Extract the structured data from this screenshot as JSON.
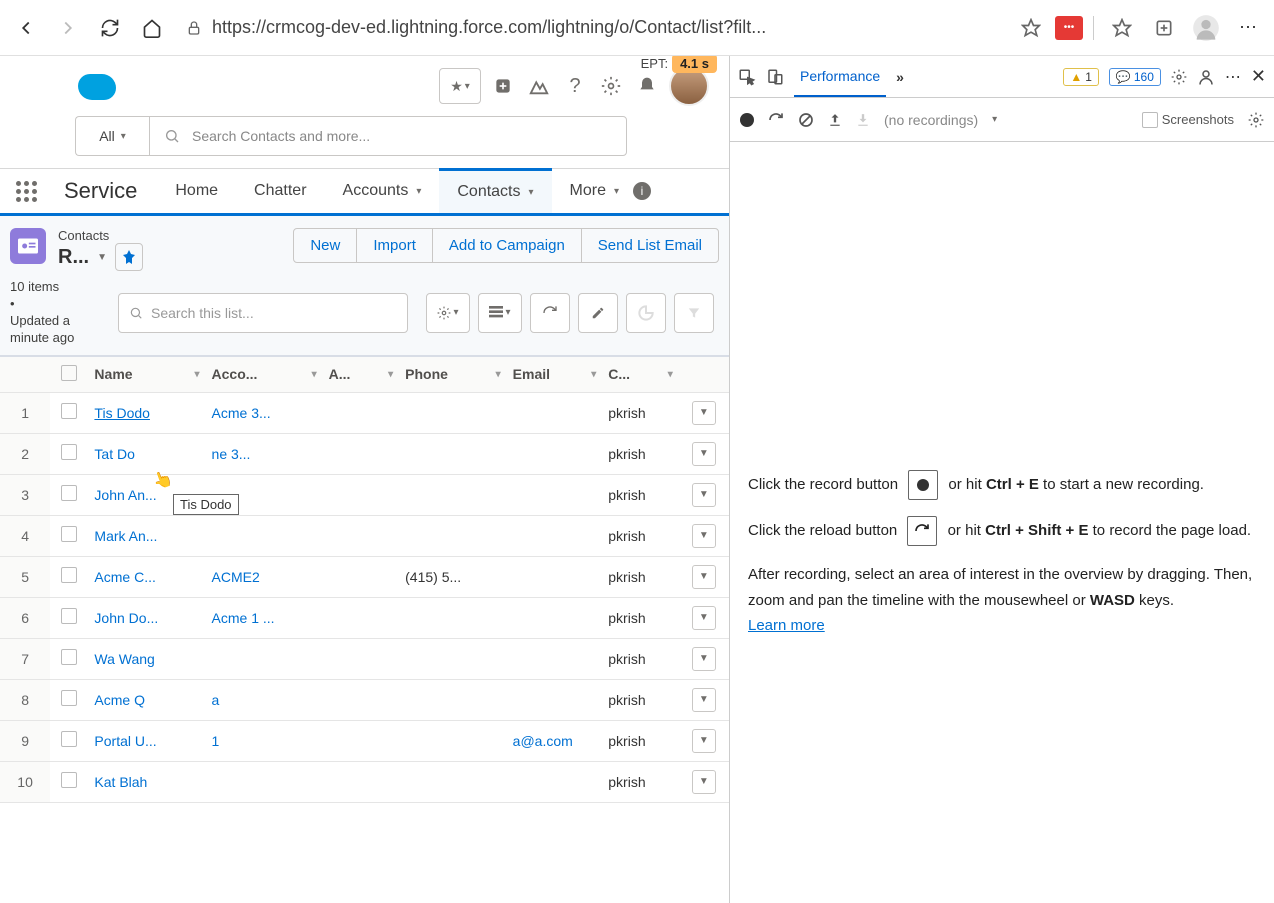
{
  "browser": {
    "url": "https://crmcog-dev-ed.lightning.force.com/lightning/o/Contact/list?filt..."
  },
  "sf": {
    "ept_label": "EPT:",
    "ept_value": "4.1 s",
    "search_scope": "All",
    "global_search_placeholder": "Search Contacts and more...",
    "app_name": "Service",
    "nav": {
      "home": "Home",
      "chatter": "Chatter",
      "accounts": "Accounts",
      "contacts": "Contacts",
      "more": "More"
    }
  },
  "list": {
    "object_label": "Contacts",
    "view_name": "R...",
    "actions": {
      "new": "New",
      "import": "Import",
      "campaign": "Add to Campaign",
      "send_email": "Send List Email"
    },
    "meta_items": "10 items",
    "meta_updated": "Updated a minute ago",
    "search_placeholder": "Search this list...",
    "tooltip": "Tis Dodo",
    "columns": {
      "name": "Name",
      "account": "Acco...",
      "a": "A...",
      "phone": "Phone",
      "email": "Email",
      "owner": "C..."
    },
    "rows": [
      {
        "num": "1",
        "name": "Tis Dodo",
        "account": "Acme 3...",
        "phone": "",
        "email": "",
        "owner": "pkrish"
      },
      {
        "num": "2",
        "name": "Tat Do",
        "account": "ne 3...",
        "phone": "",
        "email": "",
        "owner": "pkrish"
      },
      {
        "num": "3",
        "name": "John An...",
        "account": "",
        "phone": "",
        "email": "",
        "owner": "pkrish"
      },
      {
        "num": "4",
        "name": "Mark An...",
        "account": "",
        "phone": "",
        "email": "",
        "owner": "pkrish"
      },
      {
        "num": "5",
        "name": "Acme C...",
        "account": "ACME2",
        "phone": "(415) 5...",
        "email": "",
        "owner": "pkrish"
      },
      {
        "num": "6",
        "name": "John Do...",
        "account": "Acme 1 ...",
        "phone": "",
        "email": "",
        "owner": "pkrish"
      },
      {
        "num": "7",
        "name": "Wa Wang",
        "account": "",
        "phone": "",
        "email": "",
        "owner": "pkrish"
      },
      {
        "num": "8",
        "name": "Acme Q",
        "account": "a",
        "phone": "",
        "email": "",
        "owner": "pkrish"
      },
      {
        "num": "9",
        "name": "Portal U...",
        "account": "1",
        "phone": "",
        "email": "a@a.com",
        "owner": "pkrish"
      },
      {
        "num": "10",
        "name": "Kat Blah",
        "account": "",
        "phone": "",
        "email": "",
        "owner": "pkrish"
      }
    ]
  },
  "devtools": {
    "tab_performance": "Performance",
    "warn_count": "1",
    "info_count": "160",
    "no_recordings": "(no recordings)",
    "screenshots_label": "Screenshots",
    "hint1_a": "Click the record button ",
    "hint1_b": " or hit ",
    "kb1": "Ctrl + E",
    "hint1_c": " to start a new recording.",
    "hint2_a": "Click the reload button ",
    "hint2_b": " or hit ",
    "kb2": "Ctrl + Shift + E",
    "hint2_c": " to record the page load.",
    "hint3_a": "After recording, select an area of interest in the overview by dragging. Then, zoom and pan the timeline with the mousewheel or ",
    "kb3": "WASD",
    "hint3_b": " keys.",
    "learn_more": "Learn more"
  }
}
